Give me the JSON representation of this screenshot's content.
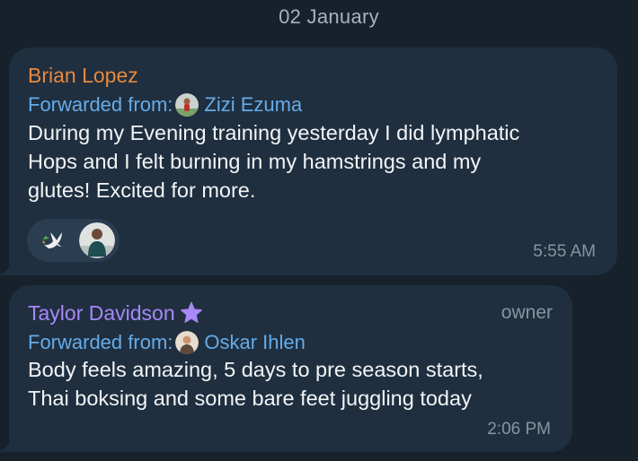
{
  "date_separator": "02 January",
  "messages": [
    {
      "sender": "Brian Lopez",
      "forwarded_label": "Forwarded from:",
      "forwarded_name": "Zizi Ezuma",
      "text_lines": [
        "During my Evening training yesterday I did lymphatic",
        "Hops and I felt burning in my hamstrings and my",
        "glutes! Excited for more."
      ],
      "reactions": [
        {
          "icon": "dove-emoji-icon"
        },
        {
          "icon": "reactor-avatar"
        }
      ],
      "time": "5:55 AM"
    },
    {
      "sender": "Taylor Davidson",
      "badge_icon": "star-icon",
      "role": "owner",
      "forwarded_label": "Forwarded from:",
      "forwarded_name": "Oskar Ihlen",
      "text_lines": [
        "Body feels amazing, 5 days to pre season starts,",
        "Thai boksing and some bare feet juggling today"
      ],
      "time": "2:06 PM"
    }
  ],
  "colors": {
    "background": "#17212b",
    "bubble": "#1f2f3f",
    "sender1": "#e8883b",
    "sender2": "#a887f7",
    "link": "#66abe8",
    "meta": "#8794a1"
  }
}
